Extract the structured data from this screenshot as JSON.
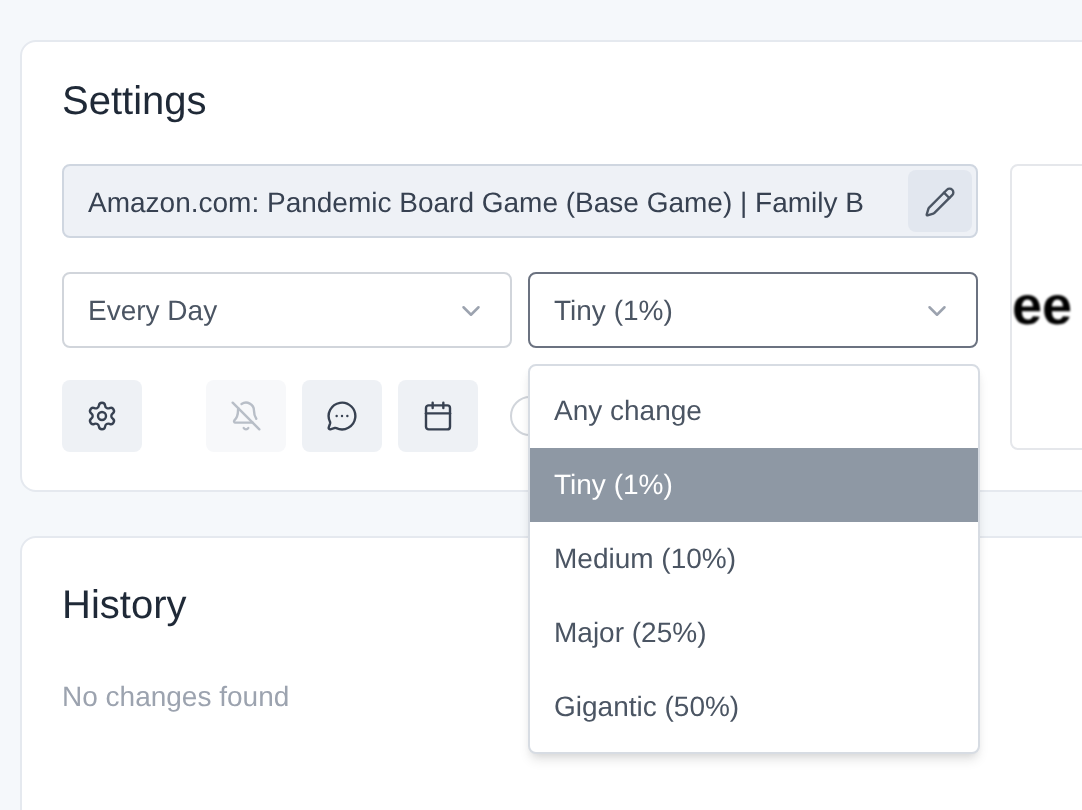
{
  "settings": {
    "title": "Settings",
    "url_field": {
      "value": "Amazon.com: Pandemic Board Game (Base Game) | Family B"
    },
    "frequency_select": {
      "value": "Every Day"
    },
    "threshold_select": {
      "value": "Tiny (1%)",
      "expanded": true
    },
    "actions": [
      {
        "kind": "settings",
        "disabled": false
      },
      {
        "kind": "notifications_off",
        "disabled": true
      },
      {
        "kind": "comment",
        "disabled": false
      },
      {
        "kind": "calendar",
        "disabled": false
      }
    ],
    "preview": {
      "text": "ee"
    }
  },
  "threshold_options": [
    {
      "label": "Any change",
      "selected": false
    },
    {
      "label": "Tiny (1%)",
      "selected": true
    },
    {
      "label": "Medium (10%)",
      "selected": false
    },
    {
      "label": "Major (25%)",
      "selected": false
    },
    {
      "label": "Gigantic (50%)",
      "selected": false
    }
  ],
  "history": {
    "title": "History",
    "empty_text": "No changes found"
  }
}
